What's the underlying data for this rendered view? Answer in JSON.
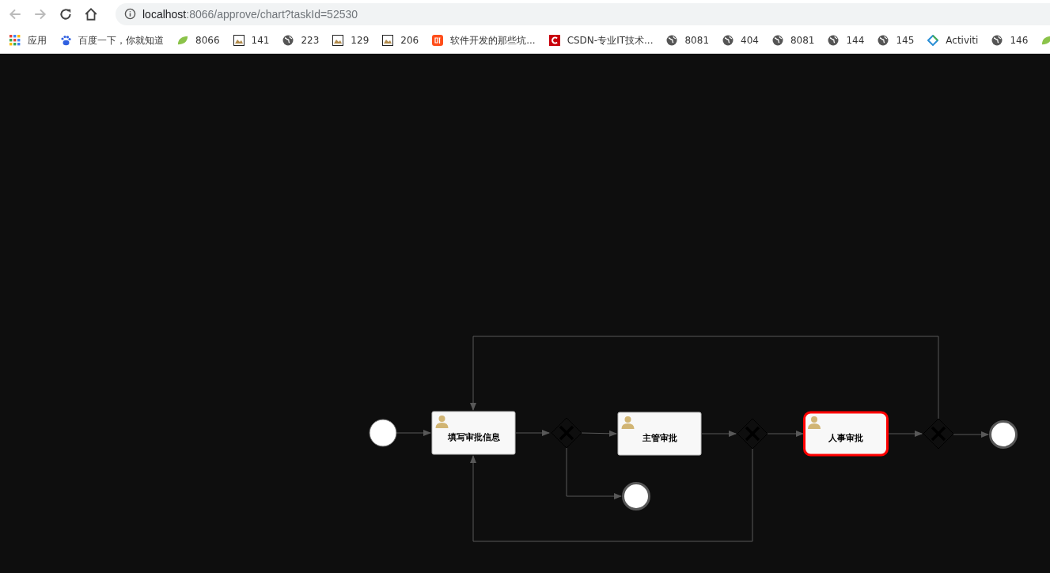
{
  "browser": {
    "url_host": "localhost",
    "url_path": ":8066/approve/chart?taskId=52530",
    "bookmarks": [
      {
        "kind": "apps",
        "label": "应用"
      },
      {
        "kind": "paw",
        "label": "百度一下，你就知道"
      },
      {
        "kind": "leaf",
        "label": "8066"
      },
      {
        "kind": "image",
        "label": "141"
      },
      {
        "kind": "globe",
        "label": "223"
      },
      {
        "kind": "image",
        "label": "129"
      },
      {
        "kind": "image",
        "label": "206"
      },
      {
        "kind": "ting",
        "label": "软件开发的那些坑..."
      },
      {
        "kind": "csdn",
        "label": "CSDN-专业IT技术..."
      },
      {
        "kind": "globe",
        "label": "8081"
      },
      {
        "kind": "globe",
        "label": "404"
      },
      {
        "kind": "globe",
        "label": "8081"
      },
      {
        "kind": "globe",
        "label": "144"
      },
      {
        "kind": "globe",
        "label": "145"
      },
      {
        "kind": "diamond",
        "label": "Activiti"
      },
      {
        "kind": "globe",
        "label": "146"
      },
      {
        "kind": "leaf"
      }
    ]
  },
  "diagram": {
    "nodes": [
      {
        "kind": "start"
      },
      {
        "kind": "task",
        "label": "填写审批信息",
        "active": false
      },
      {
        "kind": "gateway"
      },
      {
        "kind": "task",
        "label": "主管审批",
        "active": false
      },
      {
        "kind": "gateway"
      },
      {
        "kind": "task",
        "label": "人事审批",
        "active": true
      },
      {
        "kind": "gateway"
      },
      {
        "kind": "end"
      },
      {
        "kind": "end"
      }
    ]
  }
}
